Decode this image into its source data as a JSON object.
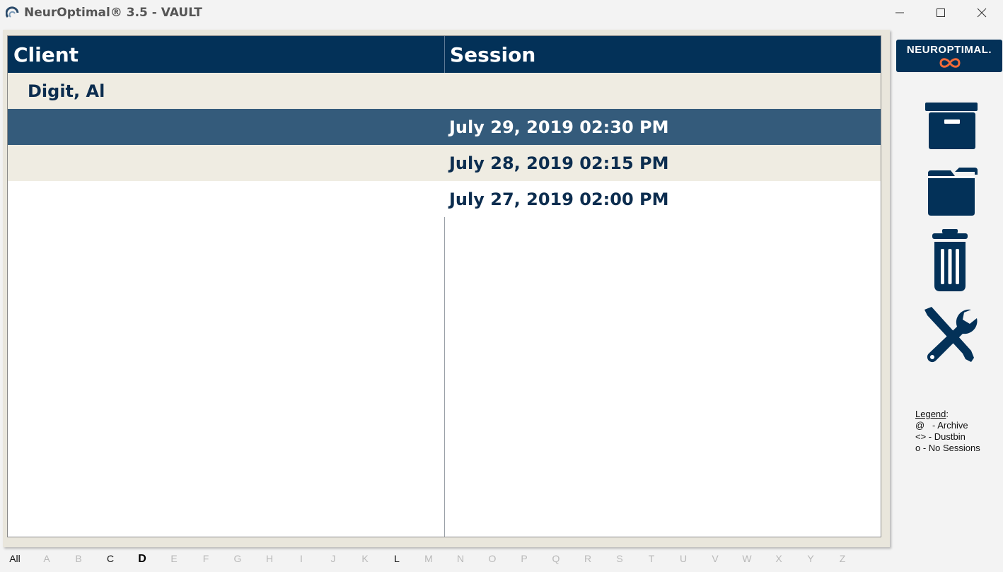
{
  "window": {
    "title": "NeurOptimal® 3.5 - VAULT"
  },
  "table": {
    "headers": {
      "client": "Client",
      "session": "Session"
    },
    "rows": [
      {
        "client": "Digit, Al",
        "session": ""
      },
      {
        "client": "",
        "session": "July 29, 2019 02:30 PM"
      },
      {
        "client": "",
        "session": "July 28, 2019 02:15 PM"
      },
      {
        "client": "",
        "session": "July 27, 2019 02:00 PM"
      }
    ],
    "selected_row": 1
  },
  "alphabet": [
    "All",
    "A",
    "B",
    "C",
    "D",
    "E",
    "F",
    "G",
    "H",
    "I",
    "J",
    "K",
    "L",
    "M",
    "N",
    "O",
    "P",
    "Q",
    "R",
    "S",
    "T",
    "U",
    "V",
    "W",
    "X",
    "Y",
    "Z"
  ],
  "sidebar": {
    "logo_text": "NEUROPTIMAL.",
    "buttons": [
      "archive-icon",
      "open-folder-icon",
      "trash-icon",
      "tools-icon"
    ]
  },
  "legend": {
    "title": "Legend",
    "title_suffix": ":",
    "lines": [
      "@   - Archive",
      "<> - Dustbin",
      "o - No Sessions"
    ]
  },
  "colors": {
    "header_bg": "#033158",
    "selected_row": "#345b7b",
    "alt_row": "#efece2",
    "text_dark": "#0c2d4f",
    "logo_accent": "#f26b3a"
  }
}
